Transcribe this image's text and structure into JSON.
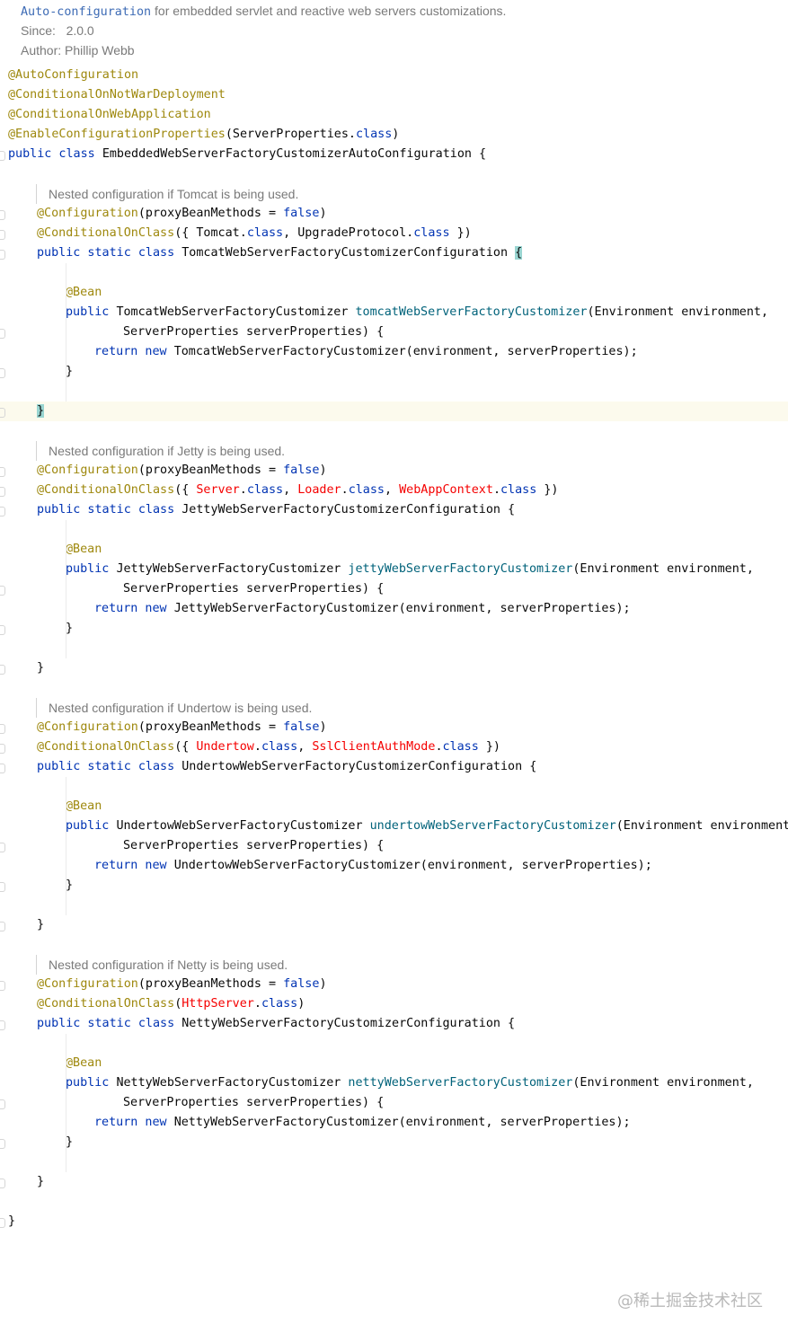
{
  "doc_header": [
    [
      {
        "t": "Auto-configuration",
        "c": "doclink"
      },
      {
        "t": " for embedded servlet and reactive web servers customizations."
      }
    ],
    [
      {
        "t": "Since:   2.0.0"
      }
    ],
    [
      {
        "t": "Author: Phillip Webb"
      }
    ]
  ],
  "lines": [
    {
      "indent": 0,
      "doc": false,
      "tokens": [
        {
          "t": "@AutoConfiguration",
          "c": "annotation"
        }
      ]
    },
    {
      "indent": 0,
      "doc": false,
      "tokens": [
        {
          "t": "@ConditionalOnNotWarDeployment",
          "c": "annotation"
        }
      ]
    },
    {
      "indent": 0,
      "doc": false,
      "tokens": [
        {
          "t": "@ConditionalOnWebApplication",
          "c": "annotation"
        }
      ]
    },
    {
      "indent": 0,
      "doc": false,
      "tokens": [
        {
          "t": "@EnableConfigurationProperties",
          "c": "annotation"
        },
        {
          "t": "(ServerProperties."
        },
        {
          "t": "class",
          "c": "keyword"
        },
        {
          "t": ")"
        }
      ]
    },
    {
      "indent": 0,
      "doc": false,
      "tokens": [
        {
          "t": "public class ",
          "c": "keyword"
        },
        {
          "t": "EmbeddedWebServerFactoryCustomizerAutoConfiguration {"
        }
      ]
    },
    {
      "indent": 0,
      "doc": false,
      "tokens": []
    },
    {
      "indent": 1,
      "doc": true,
      "tokens": [
        {
          "t": "Nested configuration if Tomcat is being used."
        }
      ]
    },
    {
      "indent": 1,
      "doc": false,
      "tokens": [
        {
          "t": "@Configuration",
          "c": "annotation"
        },
        {
          "t": "(proxyBeanMethods = "
        },
        {
          "t": "false",
          "c": "keyword"
        },
        {
          "t": ")"
        }
      ]
    },
    {
      "indent": 1,
      "doc": false,
      "tokens": [
        {
          "t": "@ConditionalOnClass",
          "c": "annotation"
        },
        {
          "t": "({ Tomcat."
        },
        {
          "t": "class",
          "c": "keyword"
        },
        {
          "t": ", UpgradeProtocol."
        },
        {
          "t": "class",
          "c": "keyword"
        },
        {
          "t": " })"
        }
      ]
    },
    {
      "indent": 1,
      "doc": false,
      "tokens": [
        {
          "t": "public static class ",
          "c": "keyword"
        },
        {
          "t": "TomcatWebServerFactoryCustomizerConfiguration "
        },
        {
          "t": "{",
          "c": "brace"
        }
      ]
    },
    {
      "indent": 0,
      "doc": false,
      "tokens": []
    },
    {
      "indent": 2,
      "doc": false,
      "tokens": [
        {
          "t": "@Bean",
          "c": "annotation"
        }
      ]
    },
    {
      "indent": 2,
      "doc": false,
      "tokens": [
        {
          "t": "public ",
          "c": "keyword"
        },
        {
          "t": "TomcatWebServerFactoryCustomizer "
        },
        {
          "t": "tomcatWebServerFactoryCustomizer",
          "c": "method"
        },
        {
          "t": "(Environment environment,"
        }
      ]
    },
    {
      "indent": 4,
      "doc": false,
      "tokens": [
        {
          "t": "ServerProperties serverProperties) {"
        }
      ]
    },
    {
      "indent": 3,
      "doc": false,
      "tokens": [
        {
          "t": "return new ",
          "c": "keyword"
        },
        {
          "t": "TomcatWebServerFactoryCustomizer(environment, serverProperties);"
        }
      ]
    },
    {
      "indent": 2,
      "doc": false,
      "tokens": [
        {
          "t": "}"
        }
      ]
    },
    {
      "indent": 0,
      "doc": false,
      "tokens": []
    },
    {
      "indent": 1,
      "doc": false,
      "highlight": true,
      "tokens": [
        {
          "t": "}",
          "c": "brace"
        }
      ]
    },
    {
      "indent": 0,
      "doc": false,
      "tokens": []
    },
    {
      "indent": 1,
      "doc": true,
      "tokens": [
        {
          "t": "Nested configuration if Jetty is being used."
        }
      ]
    },
    {
      "indent": 1,
      "doc": false,
      "tokens": [
        {
          "t": "@Configuration",
          "c": "annotation"
        },
        {
          "t": "(proxyBeanMethods = "
        },
        {
          "t": "false",
          "c": "keyword"
        },
        {
          "t": ")"
        }
      ]
    },
    {
      "indent": 1,
      "doc": false,
      "tokens": [
        {
          "t": "@ConditionalOnClass",
          "c": "annotation"
        },
        {
          "t": "({ "
        },
        {
          "t": "Server",
          "c": "error"
        },
        {
          "t": "."
        },
        {
          "t": "class",
          "c": "keyword"
        },
        {
          "t": ", "
        },
        {
          "t": "Loader",
          "c": "error"
        },
        {
          "t": "."
        },
        {
          "t": "class",
          "c": "keyword"
        },
        {
          "t": ", "
        },
        {
          "t": "WebAppContext",
          "c": "error"
        },
        {
          "t": "."
        },
        {
          "t": "class",
          "c": "keyword"
        },
        {
          "t": " })"
        }
      ]
    },
    {
      "indent": 1,
      "doc": false,
      "tokens": [
        {
          "t": "public static class ",
          "c": "keyword"
        },
        {
          "t": "JettyWebServerFactoryCustomizerConfiguration {"
        }
      ]
    },
    {
      "indent": 0,
      "doc": false,
      "tokens": []
    },
    {
      "indent": 2,
      "doc": false,
      "tokens": [
        {
          "t": "@Bean",
          "c": "annotation"
        }
      ]
    },
    {
      "indent": 2,
      "doc": false,
      "tokens": [
        {
          "t": "public ",
          "c": "keyword"
        },
        {
          "t": "JettyWebServerFactoryCustomizer "
        },
        {
          "t": "jettyWebServerFactoryCustomizer",
          "c": "method"
        },
        {
          "t": "(Environment environment,"
        }
      ]
    },
    {
      "indent": 4,
      "doc": false,
      "tokens": [
        {
          "t": "ServerProperties serverProperties) {"
        }
      ]
    },
    {
      "indent": 3,
      "doc": false,
      "tokens": [
        {
          "t": "return new ",
          "c": "keyword"
        },
        {
          "t": "JettyWebServerFactoryCustomizer(environment, serverProperties);"
        }
      ]
    },
    {
      "indent": 2,
      "doc": false,
      "tokens": [
        {
          "t": "}"
        }
      ]
    },
    {
      "indent": 0,
      "doc": false,
      "tokens": []
    },
    {
      "indent": 1,
      "doc": false,
      "tokens": [
        {
          "t": "}"
        }
      ]
    },
    {
      "indent": 0,
      "doc": false,
      "tokens": []
    },
    {
      "indent": 1,
      "doc": true,
      "tokens": [
        {
          "t": "Nested configuration if Undertow is being used."
        }
      ]
    },
    {
      "indent": 1,
      "doc": false,
      "tokens": [
        {
          "t": "@Configuration",
          "c": "annotation"
        },
        {
          "t": "(proxyBeanMethods = "
        },
        {
          "t": "false",
          "c": "keyword"
        },
        {
          "t": ")"
        }
      ]
    },
    {
      "indent": 1,
      "doc": false,
      "tokens": [
        {
          "t": "@ConditionalOnClass",
          "c": "annotation"
        },
        {
          "t": "({ "
        },
        {
          "t": "Undertow",
          "c": "error"
        },
        {
          "t": "."
        },
        {
          "t": "class",
          "c": "keyword"
        },
        {
          "t": ", "
        },
        {
          "t": "SslClientAuthMode",
          "c": "error"
        },
        {
          "t": "."
        },
        {
          "t": "class",
          "c": "keyword"
        },
        {
          "t": " })"
        }
      ]
    },
    {
      "indent": 1,
      "doc": false,
      "tokens": [
        {
          "t": "public static class ",
          "c": "keyword"
        },
        {
          "t": "UndertowWebServerFactoryCustomizerConfiguration {"
        }
      ]
    },
    {
      "indent": 0,
      "doc": false,
      "tokens": []
    },
    {
      "indent": 2,
      "doc": false,
      "tokens": [
        {
          "t": "@Bean",
          "c": "annotation"
        }
      ]
    },
    {
      "indent": 2,
      "doc": false,
      "tokens": [
        {
          "t": "public ",
          "c": "keyword"
        },
        {
          "t": "UndertowWebServerFactoryCustomizer "
        },
        {
          "t": "undertowWebServerFactoryCustomizer",
          "c": "method"
        },
        {
          "t": "(Environment environment,"
        }
      ]
    },
    {
      "indent": 4,
      "doc": false,
      "tokens": [
        {
          "t": "ServerProperties serverProperties) {"
        }
      ]
    },
    {
      "indent": 3,
      "doc": false,
      "tokens": [
        {
          "t": "return new ",
          "c": "keyword"
        },
        {
          "t": "UndertowWebServerFactoryCustomizer(environment, serverProperties);"
        }
      ]
    },
    {
      "indent": 2,
      "doc": false,
      "tokens": [
        {
          "t": "}"
        }
      ]
    },
    {
      "indent": 0,
      "doc": false,
      "tokens": []
    },
    {
      "indent": 1,
      "doc": false,
      "tokens": [
        {
          "t": "}"
        }
      ]
    },
    {
      "indent": 0,
      "doc": false,
      "tokens": []
    },
    {
      "indent": 1,
      "doc": true,
      "tokens": [
        {
          "t": "Nested configuration if Netty is being used."
        }
      ]
    },
    {
      "indent": 1,
      "doc": false,
      "tokens": [
        {
          "t": "@Configuration",
          "c": "annotation"
        },
        {
          "t": "(proxyBeanMethods = "
        },
        {
          "t": "false",
          "c": "keyword"
        },
        {
          "t": ")"
        }
      ]
    },
    {
      "indent": 1,
      "doc": false,
      "tokens": [
        {
          "t": "@ConditionalOnClass",
          "c": "annotation"
        },
        {
          "t": "("
        },
        {
          "t": "HttpServer",
          "c": "error"
        },
        {
          "t": "."
        },
        {
          "t": "class",
          "c": "keyword"
        },
        {
          "t": ")"
        }
      ]
    },
    {
      "indent": 1,
      "doc": false,
      "tokens": [
        {
          "t": "public static class ",
          "c": "keyword"
        },
        {
          "t": "NettyWebServerFactoryCustomizerConfiguration {"
        }
      ]
    },
    {
      "indent": 0,
      "doc": false,
      "tokens": []
    },
    {
      "indent": 2,
      "doc": false,
      "tokens": [
        {
          "t": "@Bean",
          "c": "annotation"
        }
      ]
    },
    {
      "indent": 2,
      "doc": false,
      "tokens": [
        {
          "t": "public ",
          "c": "keyword"
        },
        {
          "t": "NettyWebServerFactoryCustomizer "
        },
        {
          "t": "nettyWebServerFactoryCustomizer",
          "c": "method"
        },
        {
          "t": "(Environment environment,"
        }
      ]
    },
    {
      "indent": 4,
      "doc": false,
      "tokens": [
        {
          "t": "ServerProperties serverProperties) {"
        }
      ]
    },
    {
      "indent": 3,
      "doc": false,
      "tokens": [
        {
          "t": "return new ",
          "c": "keyword"
        },
        {
          "t": "NettyWebServerFactoryCustomizer(environment, serverProperties);"
        }
      ]
    },
    {
      "indent": 2,
      "doc": false,
      "tokens": [
        {
          "t": "}"
        }
      ]
    },
    {
      "indent": 0,
      "doc": false,
      "tokens": []
    },
    {
      "indent": 1,
      "doc": false,
      "tokens": [
        {
          "t": "}"
        }
      ]
    },
    {
      "indent": 0,
      "doc": false,
      "tokens": []
    },
    {
      "indent": 0,
      "doc": false,
      "tokens": [
        {
          "t": "}"
        }
      ]
    }
  ],
  "watermark": "@稀土掘金技术社区",
  "colors": {
    "annotation": "#9e880d",
    "keyword": "#0033b3",
    "method": "#00627a",
    "error": "#f50000",
    "doc_text": "#7a7a7a",
    "highlight_line": "#fcfaed",
    "brace_match": "#99d5d1"
  }
}
